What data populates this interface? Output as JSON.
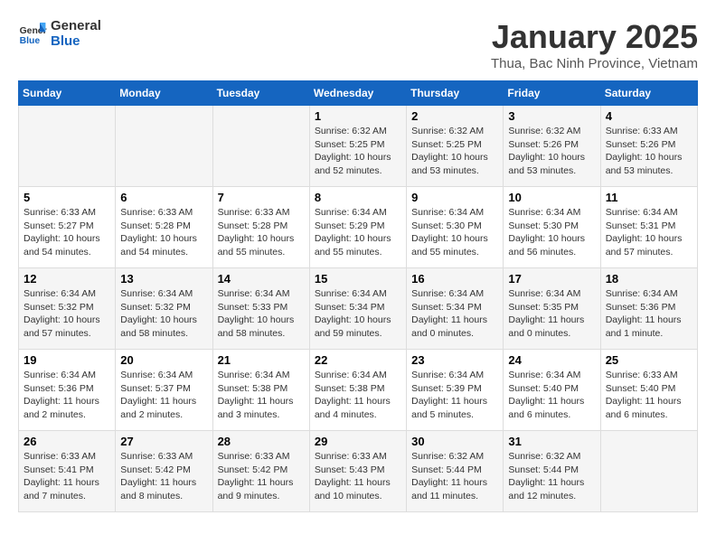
{
  "logo": {
    "line1": "General",
    "line2": "Blue"
  },
  "title": "January 2025",
  "subtitle": "Thua, Bac Ninh Province, Vietnam",
  "weekdays": [
    "Sunday",
    "Monday",
    "Tuesday",
    "Wednesday",
    "Thursday",
    "Friday",
    "Saturday"
  ],
  "weeks": [
    [
      {
        "day": "",
        "info": ""
      },
      {
        "day": "",
        "info": ""
      },
      {
        "day": "",
        "info": ""
      },
      {
        "day": "1",
        "info": "Sunrise: 6:32 AM\nSunset: 5:25 PM\nDaylight: 10 hours\nand 52 minutes."
      },
      {
        "day": "2",
        "info": "Sunrise: 6:32 AM\nSunset: 5:25 PM\nDaylight: 10 hours\nand 53 minutes."
      },
      {
        "day": "3",
        "info": "Sunrise: 6:32 AM\nSunset: 5:26 PM\nDaylight: 10 hours\nand 53 minutes."
      },
      {
        "day": "4",
        "info": "Sunrise: 6:33 AM\nSunset: 5:26 PM\nDaylight: 10 hours\nand 53 minutes."
      }
    ],
    [
      {
        "day": "5",
        "info": "Sunrise: 6:33 AM\nSunset: 5:27 PM\nDaylight: 10 hours\nand 54 minutes."
      },
      {
        "day": "6",
        "info": "Sunrise: 6:33 AM\nSunset: 5:28 PM\nDaylight: 10 hours\nand 54 minutes."
      },
      {
        "day": "7",
        "info": "Sunrise: 6:33 AM\nSunset: 5:28 PM\nDaylight: 10 hours\nand 55 minutes."
      },
      {
        "day": "8",
        "info": "Sunrise: 6:34 AM\nSunset: 5:29 PM\nDaylight: 10 hours\nand 55 minutes."
      },
      {
        "day": "9",
        "info": "Sunrise: 6:34 AM\nSunset: 5:30 PM\nDaylight: 10 hours\nand 55 minutes."
      },
      {
        "day": "10",
        "info": "Sunrise: 6:34 AM\nSunset: 5:30 PM\nDaylight: 10 hours\nand 56 minutes."
      },
      {
        "day": "11",
        "info": "Sunrise: 6:34 AM\nSunset: 5:31 PM\nDaylight: 10 hours\nand 57 minutes."
      }
    ],
    [
      {
        "day": "12",
        "info": "Sunrise: 6:34 AM\nSunset: 5:32 PM\nDaylight: 10 hours\nand 57 minutes."
      },
      {
        "day": "13",
        "info": "Sunrise: 6:34 AM\nSunset: 5:32 PM\nDaylight: 10 hours\nand 58 minutes."
      },
      {
        "day": "14",
        "info": "Sunrise: 6:34 AM\nSunset: 5:33 PM\nDaylight: 10 hours\nand 58 minutes."
      },
      {
        "day": "15",
        "info": "Sunrise: 6:34 AM\nSunset: 5:34 PM\nDaylight: 10 hours\nand 59 minutes."
      },
      {
        "day": "16",
        "info": "Sunrise: 6:34 AM\nSunset: 5:34 PM\nDaylight: 11 hours\nand 0 minutes."
      },
      {
        "day": "17",
        "info": "Sunrise: 6:34 AM\nSunset: 5:35 PM\nDaylight: 11 hours\nand 0 minutes."
      },
      {
        "day": "18",
        "info": "Sunrise: 6:34 AM\nSunset: 5:36 PM\nDaylight: 11 hours\nand 1 minute."
      }
    ],
    [
      {
        "day": "19",
        "info": "Sunrise: 6:34 AM\nSunset: 5:36 PM\nDaylight: 11 hours\nand 2 minutes."
      },
      {
        "day": "20",
        "info": "Sunrise: 6:34 AM\nSunset: 5:37 PM\nDaylight: 11 hours\nand 2 minutes."
      },
      {
        "day": "21",
        "info": "Sunrise: 6:34 AM\nSunset: 5:38 PM\nDaylight: 11 hours\nand 3 minutes."
      },
      {
        "day": "22",
        "info": "Sunrise: 6:34 AM\nSunset: 5:38 PM\nDaylight: 11 hours\nand 4 minutes."
      },
      {
        "day": "23",
        "info": "Sunrise: 6:34 AM\nSunset: 5:39 PM\nDaylight: 11 hours\nand 5 minutes."
      },
      {
        "day": "24",
        "info": "Sunrise: 6:34 AM\nSunset: 5:40 PM\nDaylight: 11 hours\nand 6 minutes."
      },
      {
        "day": "25",
        "info": "Sunrise: 6:33 AM\nSunset: 5:40 PM\nDaylight: 11 hours\nand 6 minutes."
      }
    ],
    [
      {
        "day": "26",
        "info": "Sunrise: 6:33 AM\nSunset: 5:41 PM\nDaylight: 11 hours\nand 7 minutes."
      },
      {
        "day": "27",
        "info": "Sunrise: 6:33 AM\nSunset: 5:42 PM\nDaylight: 11 hours\nand 8 minutes."
      },
      {
        "day": "28",
        "info": "Sunrise: 6:33 AM\nSunset: 5:42 PM\nDaylight: 11 hours\nand 9 minutes."
      },
      {
        "day": "29",
        "info": "Sunrise: 6:33 AM\nSunset: 5:43 PM\nDaylight: 11 hours\nand 10 minutes."
      },
      {
        "day": "30",
        "info": "Sunrise: 6:32 AM\nSunset: 5:44 PM\nDaylight: 11 hours\nand 11 minutes."
      },
      {
        "day": "31",
        "info": "Sunrise: 6:32 AM\nSunset: 5:44 PM\nDaylight: 11 hours\nand 12 minutes."
      },
      {
        "day": "",
        "info": ""
      }
    ]
  ]
}
